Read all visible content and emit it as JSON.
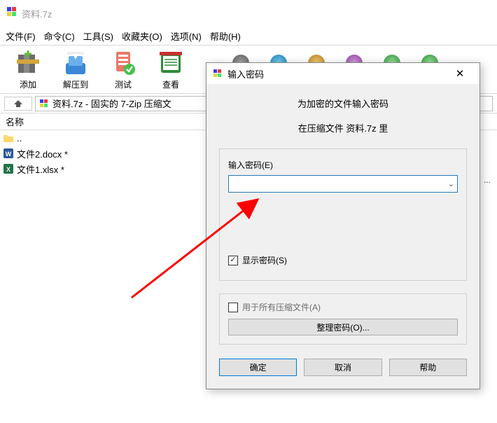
{
  "window": {
    "title": "资料.7z"
  },
  "menu": {
    "file": "文件(F)",
    "cmd": "命令(C)",
    "tools": "工具(S)",
    "fav": "收藏夹(O)",
    "options": "选项(N)",
    "help": "帮助(H)"
  },
  "toolbar": {
    "add": "添加",
    "extract": "解压到",
    "test": "测试",
    "view": "查看"
  },
  "crumb": {
    "path": "资料.7z - 固实的 7-Zip 压缩文"
  },
  "list": {
    "header": "名称",
    "rows": [
      {
        "name": ".."
      },
      {
        "name": "文件2.docx *"
      },
      {
        "name": "文件1.xlsx *"
      }
    ]
  },
  "dialog": {
    "title": "输入密码",
    "line1": "为加密的文件输入密码",
    "line2": "在压缩文件 资料.7z 里",
    "pw_label": "输入密码(E)",
    "show_pw": "显示密码(S)",
    "apply_all": "用于所有压缩文件(A)",
    "manage": "整理密码(O)...",
    "ok": "确定",
    "cancel": "取消",
    "help": "帮助"
  }
}
